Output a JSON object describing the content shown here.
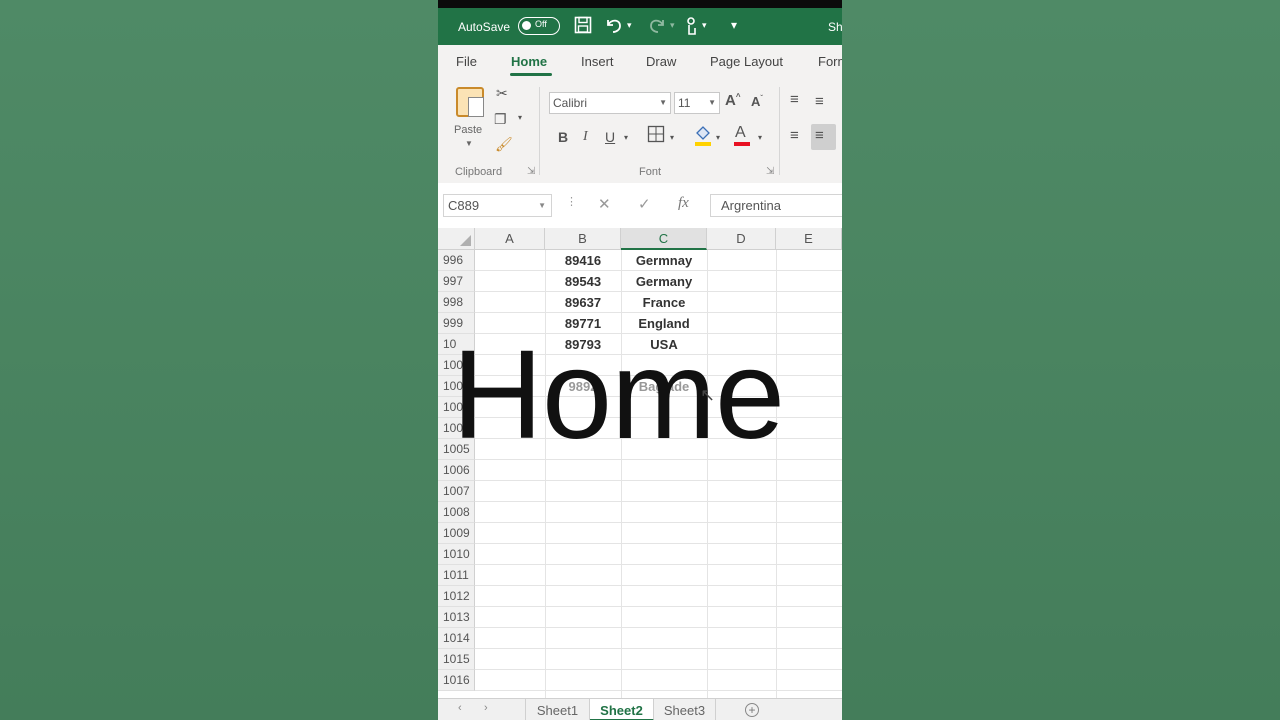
{
  "titlebar": {
    "autosave_label": "AutoSave",
    "autosave_state": "Off",
    "truncated_title": "Sh",
    "bg_color": "#217346"
  },
  "ribbon_tabs": [
    {
      "label": "File",
      "active": false
    },
    {
      "label": "Home",
      "active": true
    },
    {
      "label": "Insert",
      "active": false
    },
    {
      "label": "Draw",
      "active": false
    },
    {
      "label": "Page Layout",
      "active": false
    },
    {
      "label": "Form",
      "active": false
    }
  ],
  "ribbon": {
    "paste_label": "Paste",
    "clipboard_group": "Clipboard",
    "font_group": "Font",
    "font_name": "Calibri",
    "font_size": "11"
  },
  "formula_bar": {
    "name_box": "C889",
    "formula": "Argrentina"
  },
  "columns": [
    {
      "label": "A",
      "selected": false
    },
    {
      "label": "B",
      "selected": false
    },
    {
      "label": "C",
      "selected": true
    },
    {
      "label": "D",
      "selected": false
    },
    {
      "label": "E",
      "selected": false
    }
  ],
  "rows": [
    {
      "num": "996",
      "b": "89416",
      "c": "Germnay"
    },
    {
      "num": "997",
      "b": "89543",
      "c": "Germany"
    },
    {
      "num": "998",
      "b": "89637",
      "c": "France"
    },
    {
      "num": "999",
      "b": "89771",
      "c": "England"
    },
    {
      "num": "10",
      "b": "89793",
      "c": "USA"
    },
    {
      "num": "100",
      "b": "",
      "c": ""
    },
    {
      "num": "100",
      "b": "9892",
      "c": "Baglade"
    },
    {
      "num": "100",
      "b": "",
      "c": ""
    },
    {
      "num": "100",
      "b": "",
      "c": ""
    },
    {
      "num": "1005",
      "b": "",
      "c": ""
    },
    {
      "num": "1006",
      "b": "",
      "c": ""
    },
    {
      "num": "1007",
      "b": "",
      "c": ""
    },
    {
      "num": "1008",
      "b": "",
      "c": ""
    },
    {
      "num": "1009",
      "b": "",
      "c": ""
    },
    {
      "num": "1010",
      "b": "",
      "c": ""
    },
    {
      "num": "1011",
      "b": "",
      "c": ""
    },
    {
      "num": "1012",
      "b": "",
      "c": ""
    },
    {
      "num": "1013",
      "b": "",
      "c": ""
    },
    {
      "num": "1014",
      "b": "",
      "c": ""
    },
    {
      "num": "1015",
      "b": "",
      "c": ""
    },
    {
      "num": "1016",
      "b": "",
      "c": ""
    }
  ],
  "sheets": [
    {
      "label": "Sheet1",
      "active": false
    },
    {
      "label": "Sheet2",
      "active": true
    },
    {
      "label": "Sheet3",
      "active": false
    }
  ],
  "overlay_caption": "Home",
  "colors": {
    "excel_green": "#217346",
    "background": "#4a8560",
    "font_color_red": "#e81123",
    "highlight_yellow": "#ffd200"
  }
}
